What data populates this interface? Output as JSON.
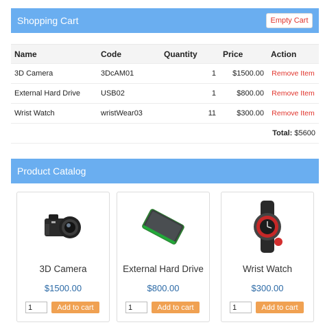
{
  "cart": {
    "title": "Shopping Cart",
    "empty_label": "Empty Cart",
    "columns": [
      "Name",
      "Code",
      "Quantity",
      "Price",
      "Action"
    ],
    "rows": [
      {
        "name": "3D Camera",
        "code": "3DcAM01",
        "quantity": "1",
        "price": "$1500.00",
        "action": "Remove Item"
      },
      {
        "name": "External Hard Drive",
        "code": "USB02",
        "quantity": "1",
        "price": "$800.00",
        "action": "Remove Item"
      },
      {
        "name": "Wrist Watch",
        "code": "wristWear03",
        "quantity": "11",
        "price": "$300.00",
        "action": "Remove Item"
      }
    ],
    "total_label": "Total:",
    "total_value": "$5600"
  },
  "catalog": {
    "title": "Product Catalog",
    "add_label": "Add to cart",
    "products": [
      {
        "name": "3D Camera",
        "price": "$1500.00",
        "qty": "1",
        "icon": "camera-icon"
      },
      {
        "name": "External Hard Drive",
        "price": "$800.00",
        "qty": "1",
        "icon": "hard-drive-icon"
      },
      {
        "name": "Wrist Watch",
        "price": "$300.00",
        "qty": "1",
        "icon": "wrist-watch-icon"
      }
    ]
  },
  "colors": {
    "header": "#6aaef0",
    "remove": "#e0332b",
    "price": "#2c6aa6",
    "button": "#f0a152"
  }
}
